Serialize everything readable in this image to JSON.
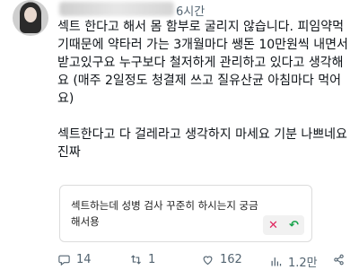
{
  "tweet": {
    "time": "6시간",
    "paragraphs": [
      "섹트 한다고 해서 몸 함부로 굴리지 않습니다. 피임약먹기때문에 약타러 가는 3개월마다 쌩돈 10만원씩 내면서 받고있구요 누구보다 철저하게 관리하고 있다고 생각해요 (매주 2일정도 청결제 쓰고 질유산균 아침마다 먹어요)",
      "섹트한다고 다 걸레라고 생각하지 마세요 기분 나쁘네요 진짜"
    ]
  },
  "reply_card": {
    "text": "섹트하는데 성병 검사 꾸준히 하시는지 궁금해서용"
  },
  "actions": {
    "replies": "14",
    "retweets": "1",
    "likes": "162",
    "views": "1.2만"
  },
  "colors": {
    "muted": "#536471",
    "text": "#0f1419",
    "x": "#e0245e",
    "undo": "#17a34a"
  }
}
